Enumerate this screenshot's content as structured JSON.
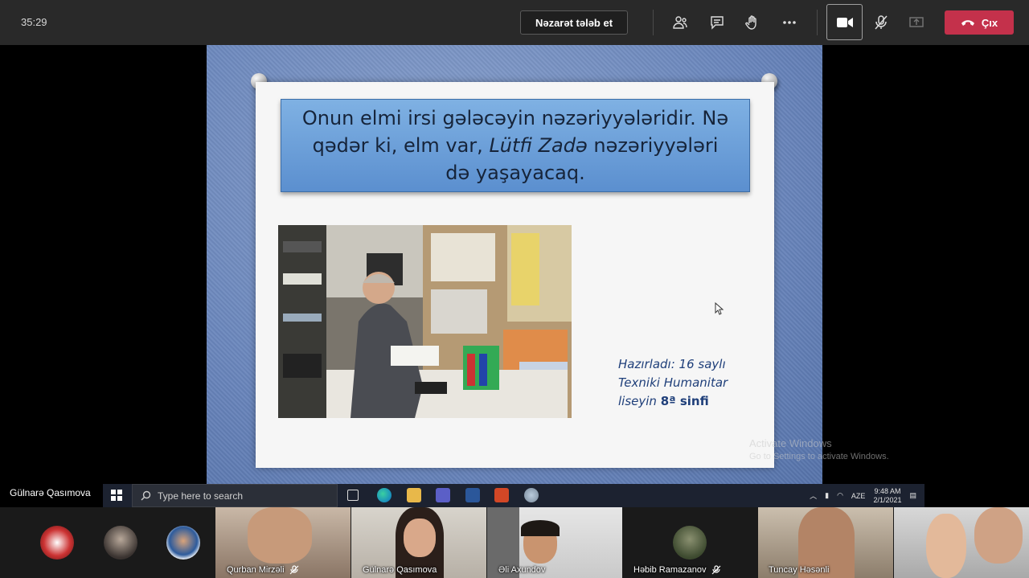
{
  "meeting": {
    "timer": "35:29",
    "request_control_label": "Nəzarət tələb et",
    "leave_label": "Çıx"
  },
  "slide": {
    "quote_part1": "Onun elmi irsi gələcəyin nəzəriyyələridir. Nə qədər ki, elm var,",
    "quote_name": "Lütfi Zadə",
    "quote_part2": "nəzəriyyələri də yaşayacaq.",
    "credit_line1": "Hazırladı: 16 saylı",
    "credit_line2": "Texniki Humanitar",
    "credit_line3_prefix": "liseyin",
    "credit_line3_bold": "8ª sinfi"
  },
  "activate_windows": {
    "title": "Activate Windows",
    "subtitle": "Go to Settings to activate Windows."
  },
  "presenter_name": "Gülnarə Qasımova",
  "taskbar": {
    "search_placeholder": "Type here to search",
    "language": "AZE",
    "time": "9:48 AM",
    "date": "2/1/2021"
  },
  "participants": [
    {
      "name": "Qurban Mirzəli",
      "muted": true
    },
    {
      "name": "Gülnarə Qasımova",
      "muted": false
    },
    {
      "name": "Əli Axundov",
      "muted": false
    },
    {
      "name": "Həbib Ramazanov",
      "muted": true
    },
    {
      "name": "Tuncay Həsənli",
      "muted": false
    }
  ],
  "colors": {
    "leave_red": "#c4314b",
    "topbar": "#292929",
    "quote_box": "#6fa2dc"
  }
}
